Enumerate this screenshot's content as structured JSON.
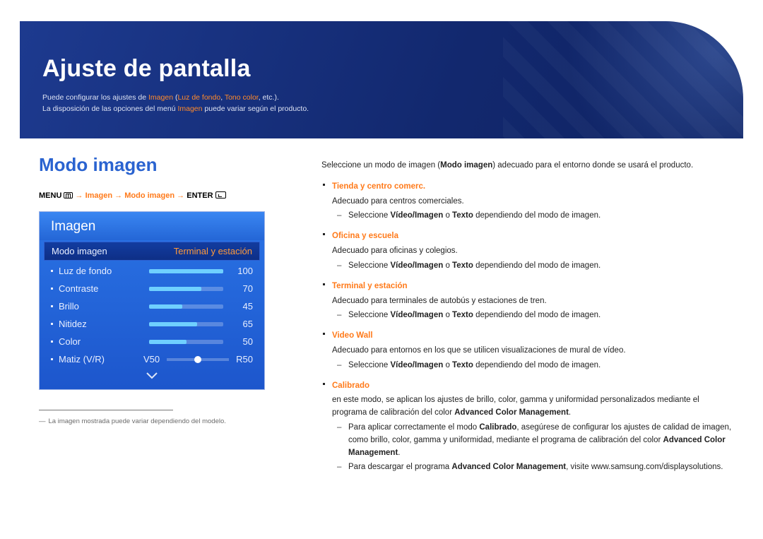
{
  "banner": {
    "title": "Ajuste de pantalla",
    "line1_pre": "Puede configurar los ajustes de ",
    "line1_kw1": "Imagen",
    "line1_paren_open": " (",
    "line1_kw2": "Luz de fondo",
    "line1_sep": ", ",
    "line1_kw3": "Tono color",
    "line1_post": ", etc.).",
    "line2_pre": "La disposición de las opciones del menú ",
    "line2_kw": "Imagen",
    "line2_post": " puede variar según el producto."
  },
  "section_title": "Modo imagen",
  "menupath": {
    "menu": "MENU",
    "arrow": " → ",
    "p1": "Imagen",
    "p2": "Modo imagen",
    "enter": "ENTER"
  },
  "osd": {
    "header": "Imagen",
    "highlight_label": "Modo imagen",
    "highlight_value": "Terminal y estación",
    "rows": [
      {
        "label": "Luz de fondo",
        "value": 100,
        "pct": 100
      },
      {
        "label": "Contraste",
        "value": 70,
        "pct": 70
      },
      {
        "label": "Brillo",
        "value": 45,
        "pct": 45
      },
      {
        "label": "Nitidez",
        "value": 65,
        "pct": 65
      },
      {
        "label": "Color",
        "value": 50,
        "pct": 50
      }
    ],
    "matiz_label": "Matiz (V/R)",
    "matiz_left": "V50",
    "matiz_right": "R50"
  },
  "footnote": "La imagen mostrada puede variar dependiendo del modelo.",
  "right": {
    "intro_pre": "Seleccione un modo de imagen (",
    "intro_bold": "Modo imagen",
    "intro_post": ") adecuado para el entorno donde se usará el producto.",
    "modes": [
      {
        "title": "Tienda y centro comerc.",
        "desc": "Adecuado para centros comerciales.",
        "sub_pre": "Seleccione ",
        "sub_b1": "Vídeo/Imagen",
        "sub_mid": " o ",
        "sub_b2": "Texto",
        "sub_post": " dependiendo del modo de imagen."
      },
      {
        "title": "Oficina y escuela",
        "desc": "Adecuado para oficinas y colegios.",
        "sub_pre": "Seleccione ",
        "sub_b1": "Vídeo/Imagen",
        "sub_mid": " o ",
        "sub_b2": "Texto",
        "sub_post": " dependiendo del modo de imagen."
      },
      {
        "title": "Terminal y estación",
        "desc": "Adecuado para terminales de autobús y estaciones de tren.",
        "sub_pre": "Seleccione ",
        "sub_b1": "Vídeo/Imagen",
        "sub_mid": " o ",
        "sub_b2": "Texto",
        "sub_post": " dependiendo del modo de imagen."
      },
      {
        "title": "Video Wall",
        "desc": "Adecuado para entornos en los que se utilicen visualizaciones de mural de vídeo.",
        "sub_pre": "Seleccione ",
        "sub_b1": "Vídeo/Imagen",
        "sub_mid": " o ",
        "sub_b2": "Texto",
        "sub_post": " dependiendo del modo de imagen."
      }
    ],
    "calibrado": {
      "title": "Calibrado",
      "desc_pre": "en este modo, se aplican los ajustes de brillo, color, gamma y uniformidad personalizados mediante el programa de calibración del color ",
      "desc_b": "Advanced Color Management",
      "desc_post": ".",
      "s1_pre": "Para aplicar correctamente el modo ",
      "s1_b1": "Calibrado",
      "s1_mid": ", asegúrese de configurar los ajustes de calidad de imagen, como brillo, color, gamma y uniformidad, mediante el programa de calibración del color ",
      "s1_b2": "Advanced Color Management",
      "s1_post": ".",
      "s2_pre": "Para descargar el programa ",
      "s2_b": "Advanced Color Management",
      "s2_post": ", visite www.samsung.com/displaysolutions."
    }
  }
}
